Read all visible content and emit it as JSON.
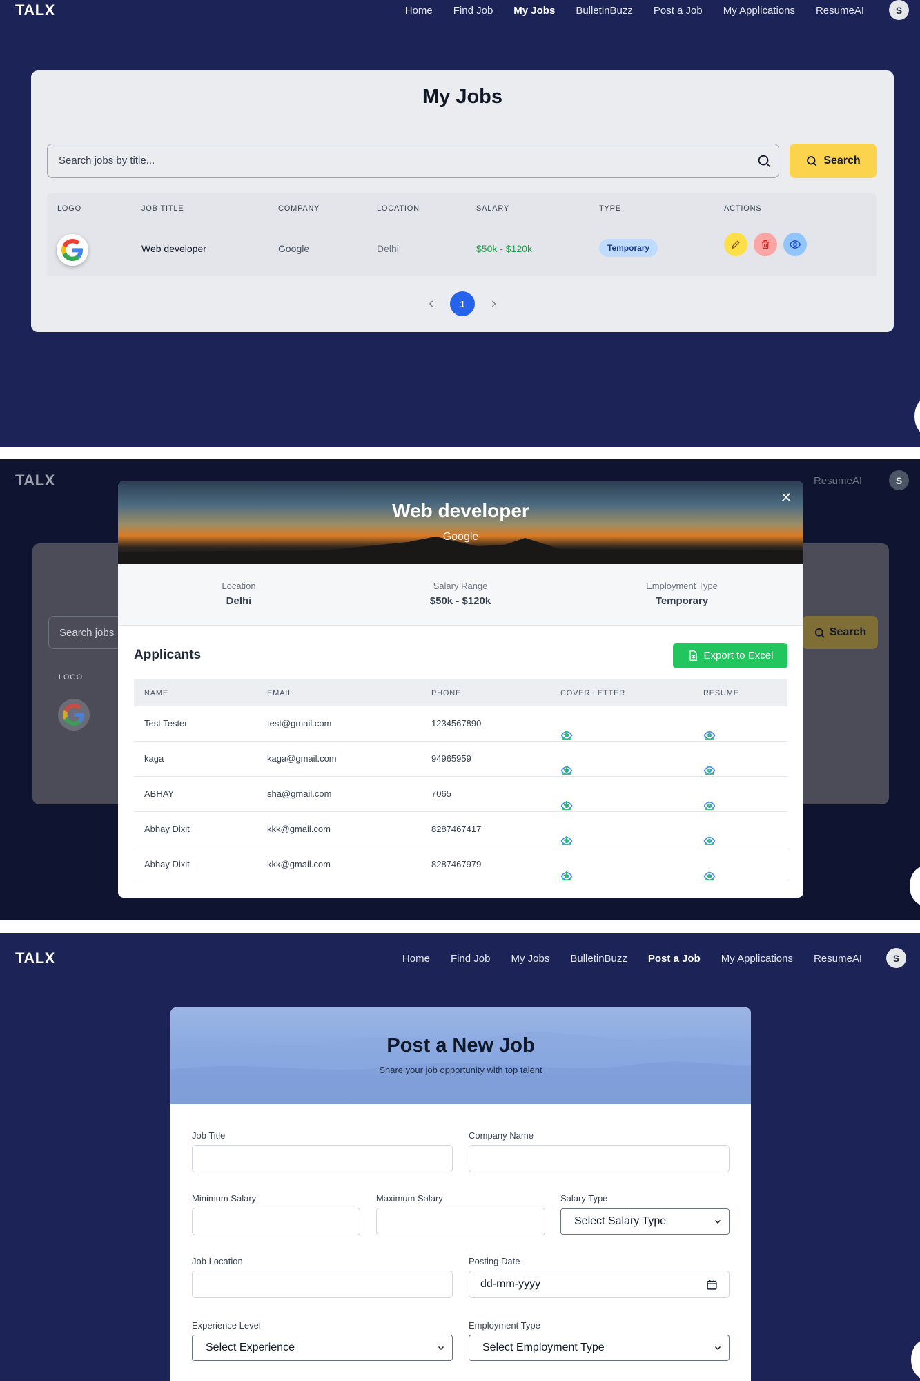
{
  "nav": {
    "brand": "TALX",
    "links": [
      "Home",
      "Find Job",
      "My Jobs",
      "BulletinBuzz",
      "Post a Job",
      "My Applications",
      "ResumeAI"
    ],
    "avatar": "S"
  },
  "my_jobs": {
    "title": "My Jobs",
    "search_placeholder": "Search jobs by title...",
    "search_button": "Search",
    "headers": [
      "LOGO",
      "JOB TITLE",
      "COMPANY",
      "LOCATION",
      "SALARY",
      "TYPE",
      "ACTIONS"
    ],
    "row": {
      "title": "Web developer",
      "company": "Google",
      "location": "Delhi",
      "salary": "$50k - $120k",
      "type": "Temporary"
    },
    "page": "1"
  },
  "modal": {
    "title": "Web developer",
    "company": "Google",
    "stats": [
      {
        "label": "Location",
        "value": "Delhi"
      },
      {
        "label": "Salary Range",
        "value": "$50k - $120k"
      },
      {
        "label": "Employment Type",
        "value": "Temporary"
      }
    ],
    "applicants_heading": "Applicants",
    "export_button": "Export to Excel",
    "headers": [
      "NAME",
      "EMAIL",
      "PHONE",
      "COVER LETTER",
      "RESUME"
    ],
    "applicants": [
      {
        "name": "Test Tester",
        "email": "test@gmail.com",
        "phone": "1234567890"
      },
      {
        "name": "kaga",
        "email": "kaga@gmail.com",
        "phone": "94965959"
      },
      {
        "name": "ABHAY",
        "email": "sha@gmail.com",
        "phone": "7065"
      },
      {
        "name": "Abhay Dixit",
        "email": "kkk@gmail.com",
        "phone": "8287467417"
      },
      {
        "name": "Abhay Dixit",
        "email": "kkk@gmail.com",
        "phone": "8287467979"
      }
    ],
    "bg_search_fragment": "Search jobs",
    "bg_logo_label": "LOGO",
    "bg_search_button": "Search"
  },
  "post_job": {
    "title": "Post a New Job",
    "subtitle": "Share your job opportunity with top talent",
    "fields": {
      "job_title": "Job Title",
      "company_name": "Company Name",
      "min_salary": "Minimum Salary",
      "max_salary": "Maximum Salary",
      "salary_type": "Salary Type",
      "job_location": "Job Location",
      "posting_date": "Posting Date",
      "experience_level": "Experience Level",
      "employment_type": "Employment Type"
    },
    "salary_type_selected": "Select Salary Type",
    "date_placeholder": "dd-mm-yyyy",
    "experience_selected": "Select Experience",
    "employment_selected": "Select Employment Type"
  },
  "colors": {
    "navy": "#1c2457",
    "accent_yellow": "#fcd34d",
    "primary_blue": "#2563eb",
    "green": "#22c55e",
    "red": "#f87171"
  }
}
